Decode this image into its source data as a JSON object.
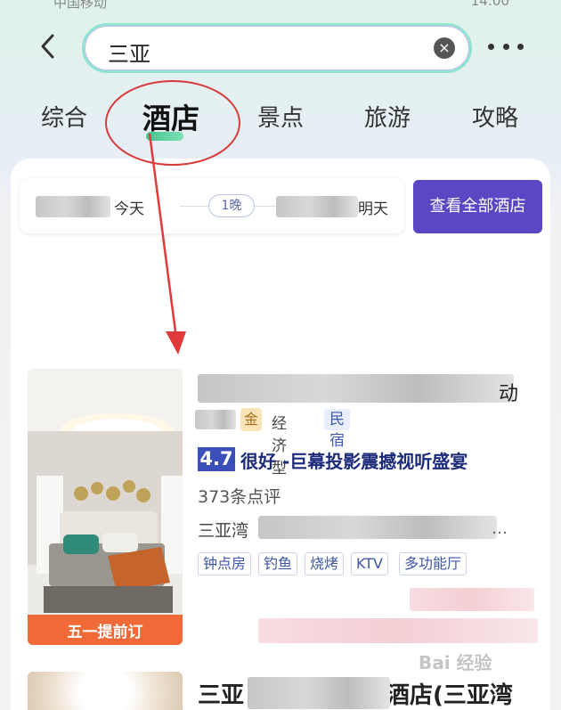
{
  "status_bar": {
    "carrier": "中国移动",
    "clock": "14:00"
  },
  "search": {
    "query": "三亚"
  },
  "tabs": [
    {
      "label": "综合",
      "active": false
    },
    {
      "label": "酒店",
      "active": true
    },
    {
      "label": "景点",
      "active": false
    },
    {
      "label": "旅游",
      "active": false
    },
    {
      "label": "攻略",
      "active": false
    }
  ],
  "dates": {
    "checkin_label": "今天",
    "nights": "1晚",
    "checkout_label": "明天"
  },
  "view_all_button": "查看全部酒店",
  "hotel": {
    "title_tail": "动",
    "gold_badge": "金",
    "type": "经济型",
    "tag": "民宿",
    "score": "4.7",
    "score_text": "很好 -巨幕投影震撼视听盛宴",
    "review_count": "373条点评",
    "location": "三亚湾",
    "location_ellipsis": "…",
    "promo_banner": "五一提前订",
    "amenities": [
      "钟点房",
      "钓鱼",
      "烧烤",
      "KTV",
      "多功能厅"
    ]
  },
  "hotel2": {
    "title_start": "三亚",
    "title_end": "酒店(三亚湾"
  },
  "watermark": "Bai 经验",
  "colors": {
    "accent": "#5d46c4",
    "annotation": "#d83a3a",
    "tab_indicator": "#3ec58c",
    "score_badge": "#3b4fb8"
  }
}
